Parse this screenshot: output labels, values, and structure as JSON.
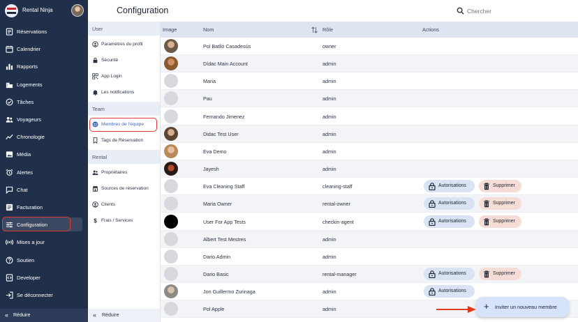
{
  "brand": {
    "name": "Rental Ninja"
  },
  "nav": {
    "items": [
      {
        "label": "Réservations",
        "icon": "reservations-icon",
        "active": false
      },
      {
        "label": "Calendrier",
        "icon": "calendar-icon",
        "active": false
      },
      {
        "label": "Rapports",
        "icon": "reports-icon",
        "active": false
      },
      {
        "label": "Logements",
        "icon": "buildings-icon",
        "active": false
      },
      {
        "label": "Tâches",
        "icon": "tasks-check-icon",
        "active": false
      },
      {
        "label": "Voyageurs",
        "icon": "travellers-icon",
        "active": false
      },
      {
        "label": "Chronologie",
        "icon": "timeline-icon",
        "active": false
      },
      {
        "label": "Média",
        "icon": "media-icon",
        "active": false
      },
      {
        "label": "Alertes",
        "icon": "alarm-icon",
        "active": false
      },
      {
        "label": "Chat",
        "icon": "chat-icon",
        "active": false
      },
      {
        "label": "Facturation",
        "icon": "billing-icon",
        "active": false
      },
      {
        "label": "Configuration",
        "icon": "settings-sliders-icon",
        "active": true
      },
      {
        "label": "Mises a jour",
        "icon": "updates-broadcast-icon",
        "active": false
      },
      {
        "label": "Soutien",
        "icon": "help-icon",
        "active": false
      },
      {
        "label": "Developer",
        "icon": "developer-icon",
        "active": false
      },
      {
        "label": "Se déconnecter",
        "icon": "logout-icon",
        "active": false
      }
    ],
    "collapse_label": "Réduire"
  },
  "header": {
    "title": "Configuration",
    "search_placeholder": "Chercher"
  },
  "settings_menu": {
    "sections": [
      {
        "title": "User",
        "items": [
          {
            "label": "Paramètres du profil",
            "icon": "profile-icon"
          },
          {
            "label": "Sécurité",
            "icon": "lock-icon"
          },
          {
            "label": "App Login",
            "icon": "qr-code-icon"
          },
          {
            "label": "Les notifications",
            "icon": "bell-icon"
          }
        ]
      },
      {
        "title": "Team",
        "items": [
          {
            "label": "Membres de l'équipe",
            "icon": "team-members-icon",
            "active": true
          },
          {
            "label": "Tags de Réservation",
            "icon": "bookmark-icon"
          }
        ]
      },
      {
        "title": "Rental",
        "items": [
          {
            "label": "Propriétaires",
            "icon": "owners-icon"
          },
          {
            "label": "Sources de réservation",
            "icon": "store-icon"
          },
          {
            "label": "Clients",
            "icon": "clients-icon"
          },
          {
            "label": "Frais / Services",
            "icon": "dollar-icon"
          }
        ]
      }
    ],
    "collapse_label": "Réduire"
  },
  "table": {
    "columns": {
      "image": "Image",
      "name": "Nom",
      "role": "Rôle",
      "actions": "Actions"
    },
    "permissions_label": "Autorisations",
    "delete_label": "Supprimer",
    "rows": [
      {
        "name": "Pol Batlló Casadesús",
        "role": "owner",
        "avatar": "photo",
        "perm": false,
        "del": false
      },
      {
        "name": "Dídac Main Account",
        "role": "admin",
        "avatar": "photo",
        "perm": false,
        "del": false
      },
      {
        "name": "Maria",
        "role": "admin",
        "avatar": "placeholder",
        "perm": false,
        "del": false
      },
      {
        "name": "Pau",
        "role": "admin",
        "avatar": "placeholder",
        "perm": false,
        "del": false
      },
      {
        "name": "Fernando Jimenez",
        "role": "admin",
        "avatar": "placeholder",
        "perm": false,
        "del": false
      },
      {
        "name": "Didac Test User",
        "role": "admin",
        "avatar": "photo",
        "perm": false,
        "del": false
      },
      {
        "name": "Eva Demo",
        "role": "admin",
        "avatar": "photo",
        "perm": false,
        "del": false
      },
      {
        "name": "Jayesh",
        "role": "admin",
        "avatar": "photo",
        "perm": false,
        "del": false
      },
      {
        "name": "Eva Cleaning Staff",
        "role": "cleaning-staff",
        "avatar": "placeholder",
        "perm": true,
        "del": true
      },
      {
        "name": "Maria Owner",
        "role": "rental-owner",
        "avatar": "placeholder",
        "perm": true,
        "del": true
      },
      {
        "name": "User For App Tests",
        "role": "checkin-agent",
        "avatar": "black",
        "perm": true,
        "del": true
      },
      {
        "name": "Albert Test Mestres",
        "role": "admin",
        "avatar": "placeholder",
        "perm": false,
        "del": false
      },
      {
        "name": "Dario Admin",
        "role": "admin",
        "avatar": "placeholder",
        "perm": false,
        "del": false
      },
      {
        "name": "Dario Basic",
        "role": "rental-manager",
        "avatar": "placeholder",
        "perm": true,
        "del": true
      },
      {
        "name": "Jon Guillermo Zurinaga",
        "role": "admin",
        "avatar": "photo",
        "perm": true,
        "del": false
      },
      {
        "name": "Pol Apple",
        "role": "admin",
        "avatar": "placeholder",
        "perm": false,
        "del": false
      }
    ]
  },
  "fab": {
    "label": "Inviter un nouveau membre",
    "icon": "plus-icon"
  },
  "colors": {
    "nav_bg": "#21304a",
    "accent": "#3f66b5",
    "highlight": "#e53935"
  }
}
